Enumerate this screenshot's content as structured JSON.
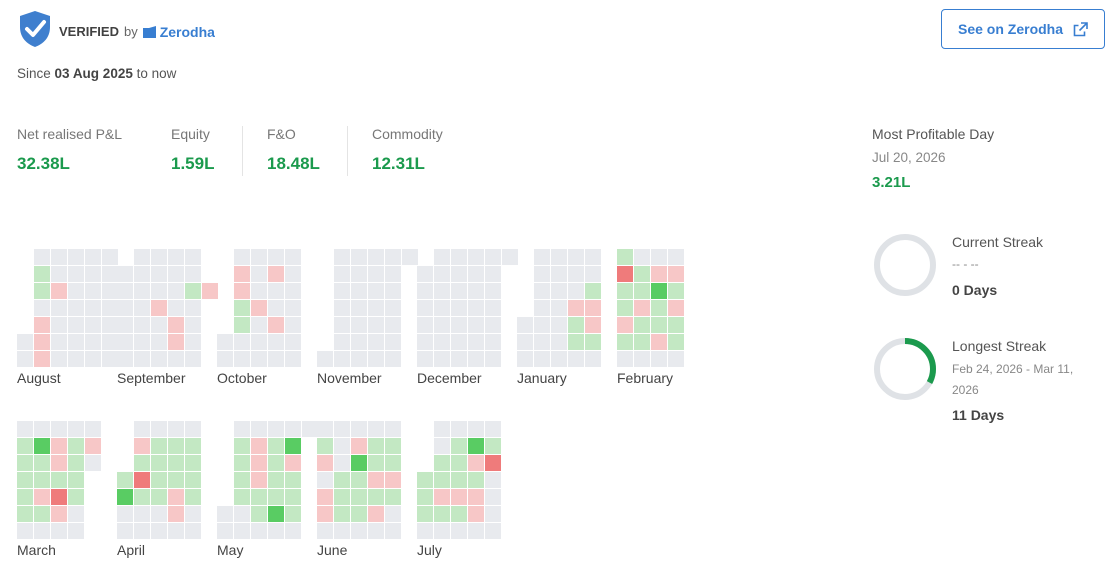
{
  "header": {
    "verified_label": "VERIFIED",
    "by_label": "by",
    "broker_name": "Zerodha",
    "see_button_label": "See on Zerodha"
  },
  "since": {
    "prefix": "Since",
    "date": "03 Aug 2025",
    "suffix": "to now"
  },
  "pnl": [
    {
      "label": "Net realised P&L",
      "value": "32.38L"
    },
    {
      "label": "Equity",
      "value": "1.59L"
    },
    {
      "label": "F&O",
      "value": "18.48L"
    },
    {
      "label": "Commodity",
      "value": "12.31L"
    }
  ],
  "most_profitable": {
    "title": "Most Profitable Day",
    "date": "Jul 20, 2026",
    "value": "3.21L"
  },
  "current_streak": {
    "title": "Current Streak",
    "range": "-- - --",
    "value": "0 Days",
    "progress": 0
  },
  "longest_streak": {
    "title": "Longest Streak",
    "range_line1": "Feb 24, 2026 - Mar 11,",
    "range_line2": "2026",
    "value": "11 Days",
    "progress": 0.33
  },
  "colors": {
    "none": "#e8eaee",
    "profit_light": "#e2f5e2",
    "profit_mid": "#c3e8c3",
    "profit_high": "#9ddf9f",
    "profit_max": "#59cc63",
    "loss_light": "#fbe4e4",
    "loss_mid": "#f7c7c7",
    "loss_max": "#ef7b7b",
    "accent": "#387ed1",
    "green": "#1b9a4d",
    "ring_track": "#dfe2e6",
    "ring_fill": "#1b9a4d"
  },
  "heatmap_legend": "0=no trade, g1..g4 profit intensity, r1..r3 loss intensity",
  "months": [
    {
      "name": "August",
      "rows": [
        ". # # # # #",
        ". g # # # #",
        ". g r # # #",
        ". # # # # #",
        ". r # # # #",
        "# r # # # #",
        "# r # # # #"
      ]
    },
    {
      "name": "September",
      "rows": [
        ". # # # # .",
        "# # # # # .",
        "# # # # g r",
        "# # r # # .",
        "# # # r # .",
        "# # # r # .",
        "# # # # # ."
      ]
    },
    {
      "name": "October",
      "rows": [
        ". # # # # .",
        ". r # r # .",
        ". r # # # .",
        ". g r # # .",
        ". g # r # .",
        "# # # # # .",
        "# # # # # ."
      ]
    },
    {
      "name": "November",
      "rows": [
        ". # # # # #",
        ". # # # # .",
        ". # # # # .",
        ". # # # # .",
        ". # # # # .",
        ". # # # # .",
        "# # # # # ."
      ]
    },
    {
      "name": "December",
      "rows": [
        ". # # # # #",
        "# # # # # .",
        "# # # # # .",
        "# # # # # .",
        "# # # # # .",
        "# # # # # .",
        "# # # # # ."
      ]
    },
    {
      "name": "January",
      "rows": [
        ". # # # # .",
        ". # # # # .",
        ". # # # g .",
        ". # # r r .",
        "# # # g r .",
        "# # # g g .",
        "# # # # # ."
      ]
    },
    {
      "name": "February",
      "rows": [
        "g # # # .",
        "R g r r .",
        "g g G g .",
        "g r g r .",
        "r g g g .",
        "g g r g .",
        "# # # # ."
      ]
    },
    {
      "name": "March",
      "rows": [
        "# # # # # .",
        "g G r g r .",
        "g g r g # .",
        "g g g g . .",
        "g r R g . .",
        "g g r # . .",
        "# # # # . ."
      ]
    },
    {
      "name": "April",
      "rows": [
        ". # # # # .",
        ". r g g g .",
        ". g g g g .",
        "g R g g g .",
        "G g g r g .",
        "# # # r # .",
        "# # # # # ."
      ]
    },
    {
      "name": "May",
      "rows": [
        ". # # # # #",
        ". g r g G .",
        ". g r g r .",
        ". g r g g .",
        ". g g g g .",
        "# # g G g .",
        "# # # # # ."
      ]
    },
    {
      "name": "June",
      "rows": [
        "# # # # # .",
        "g # r g g .",
        "r # G g g .",
        "# g g r r .",
        "r g g g g .",
        "r g g r # .",
        "# # # # # ."
      ]
    },
    {
      "name": "July",
      "rows": [
        ". # # # # .",
        ". # g G g .",
        ". g g r R .",
        "g g g g # .",
        "g r r r # .",
        "g g g r # .",
        "# # # # # ."
      ]
    }
  ]
}
